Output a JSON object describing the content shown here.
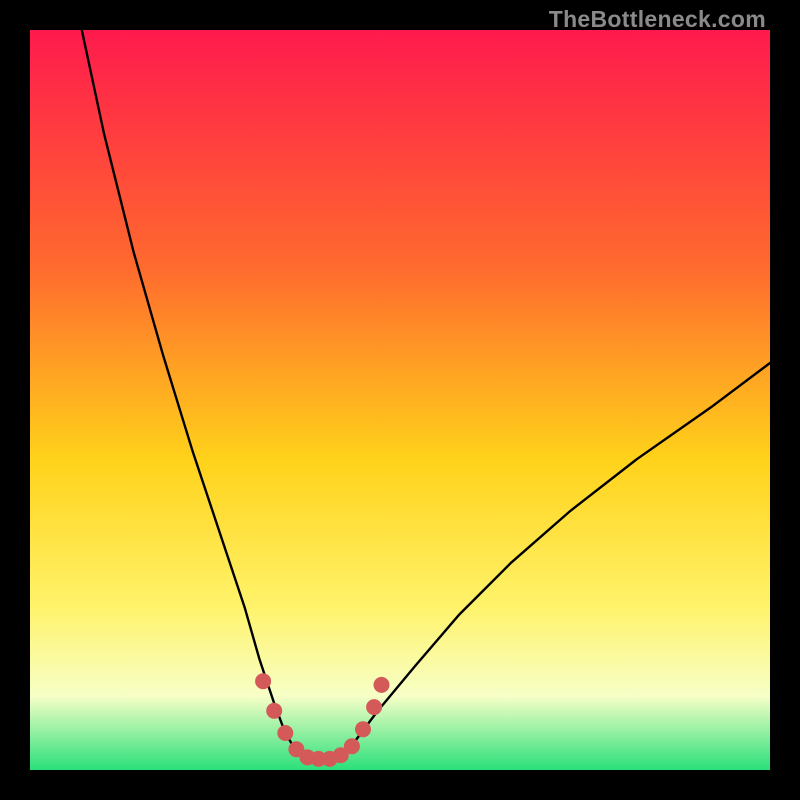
{
  "watermark": "TheBottleneck.com",
  "colors": {
    "bg": "#000000",
    "grad_top": "#ff1a4d",
    "grad_upper": "#ff6a2e",
    "grad_mid": "#ffd21a",
    "grad_lower": "#fff36b",
    "grad_pale": "#f7ffc7",
    "grad_green": "#29e07a",
    "curve": "#000000",
    "marker": "#d45a5a"
  },
  "chart_data": {
    "type": "line",
    "title": "",
    "xlabel": "",
    "ylabel": "",
    "xlim": [
      0,
      100
    ],
    "ylim": [
      0,
      100
    ],
    "series": [
      {
        "name": "bottleneck-curve",
        "x": [
          7,
          10,
          14,
          18,
          22,
          26,
          29,
          31,
          33,
          34.5,
          36,
          38,
          40,
          42,
          44,
          47,
          52,
          58,
          65,
          73,
          82,
          92,
          100
        ],
        "y": [
          100,
          86,
          70,
          56,
          43,
          31,
          22,
          15,
          9,
          5,
          2.5,
          1.5,
          1.5,
          2,
          4,
          8,
          14,
          21,
          28,
          35,
          42,
          49,
          55
        ]
      }
    ],
    "markers": {
      "name": "highlight-region",
      "x": [
        31.5,
        33,
        34.5,
        36,
        37.5,
        39,
        40.5,
        42,
        43.5,
        45,
        46.5,
        47.5
      ],
      "y": [
        12,
        8,
        5,
        2.8,
        1.7,
        1.5,
        1.5,
        2,
        3.2,
        5.5,
        8.5,
        11.5
      ]
    }
  }
}
